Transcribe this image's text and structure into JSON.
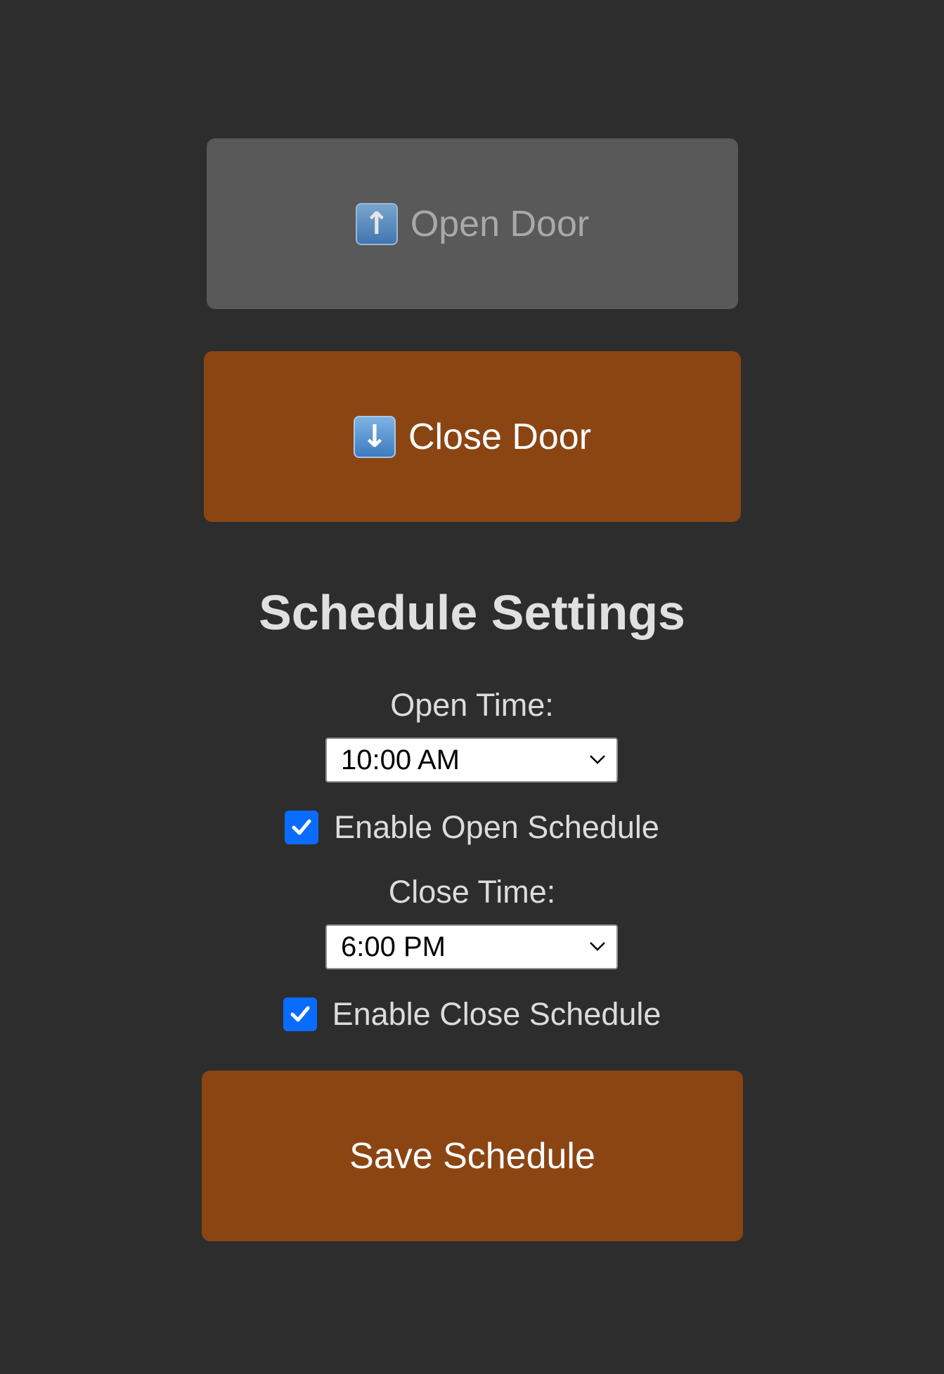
{
  "controls": {
    "open_door_label": "Open Door",
    "open_door_icon": "up-arrow-icon",
    "close_door_label": "Close Door",
    "close_door_icon": "down-arrow-icon"
  },
  "schedule": {
    "title": "Schedule Settings",
    "open_time_label": "Open Time:",
    "open_time_value": "10:00 AM",
    "open_enabled_label": "Enable Open Schedule",
    "open_enabled": true,
    "close_time_label": "Close Time:",
    "close_time_value": "6:00 PM",
    "close_enabled_label": "Enable Close Schedule",
    "close_enabled": true,
    "save_label": "Save Schedule"
  },
  "colors": {
    "background": "#2d2d2d",
    "accent": "#8b4513",
    "disabled_button": "#595959",
    "checkbox": "#0a6cff"
  }
}
